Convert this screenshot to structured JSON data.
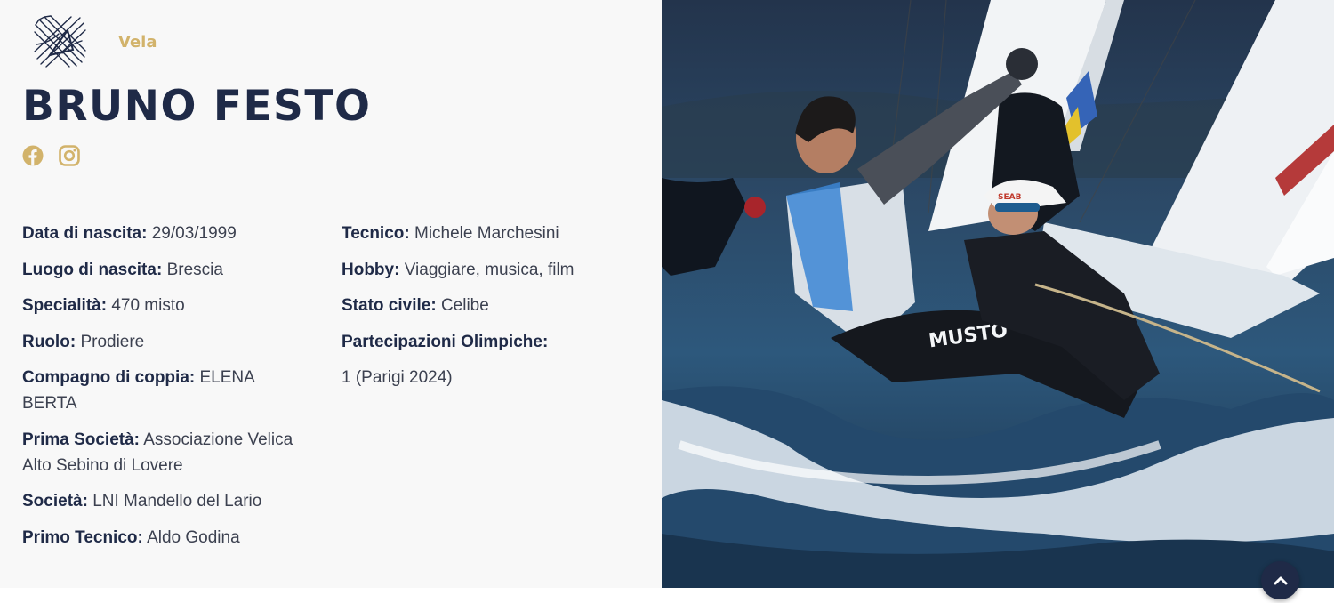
{
  "sport": {
    "label": "Vela",
    "icon": "sailing-discipline-icon"
  },
  "athlete": {
    "name": "BRUNO FESTO"
  },
  "social": [
    {
      "icon": "facebook-icon",
      "color": "#d2b36b"
    },
    {
      "icon": "instagram-icon",
      "color": "#d2b36b"
    }
  ],
  "details_left": [
    {
      "label": "Data di nascita:",
      "value": "29/03/1999"
    },
    {
      "label": "Luogo di nascita:",
      "value": "Brescia"
    },
    {
      "label": "Specialità:",
      "value": "470 misto"
    },
    {
      "label": "Ruolo:",
      "value": "Prodiere"
    },
    {
      "label": "Compagno di coppia:",
      "value": "ELENA BERTA"
    },
    {
      "label": "Prima Società:",
      "value": "Associazione Velica Alto Sebino di Lovere"
    },
    {
      "label": "Società:",
      "value": "LNI Mandello del Lario"
    },
    {
      "label": "Primo Tecnico:",
      "value": "Aldo Godina"
    }
  ],
  "details_right": [
    {
      "label": "Tecnico:",
      "value": "Michele Marchesini"
    },
    {
      "label": "Hobby:",
      "value": "Viaggiare, musica, film"
    },
    {
      "label": "Stato civile:",
      "value": "Celibe"
    },
    {
      "label": "Partecipazioni Olimpiche:",
      "value": ""
    },
    {
      "label": "",
      "value": "1 (Parigi 2024)"
    }
  ],
  "photo": {
    "wetsuit_brand": "MUSTO",
    "cap_text": "SEAB"
  },
  "scroll_top": {
    "icon": "chevron-up-icon"
  },
  "colors": {
    "accent": "#d2b36b",
    "navy": "#1f2a47",
    "panel": "#f8f8f8"
  }
}
